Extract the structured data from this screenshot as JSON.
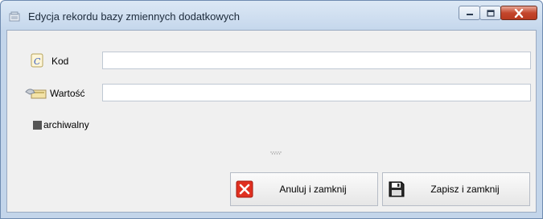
{
  "window": {
    "title": "Edycja rekordu bazy zmiennych dodatkowych",
    "controls": {
      "minimize": "minimize",
      "maximize": "maximize",
      "close": "close"
    }
  },
  "form": {
    "kod": {
      "label": "Kod",
      "value": "",
      "icon": "document-c-icon"
    },
    "wartosc": {
      "label": "Wartość",
      "value": "",
      "icon": "value-hand-icon"
    },
    "archiwalny": {
      "label": "archiwalny",
      "checked": true
    }
  },
  "buttons": {
    "cancel": {
      "label": "Anuluj i zamknij",
      "icon": "red-x-icon"
    },
    "save": {
      "label": "Zapisz i zamknij",
      "icon": "floppy-disk-icon"
    }
  },
  "colors": {
    "title_bar": "#c5d7ec",
    "close_button": "#c4472d",
    "client_bg": "#f0f0f0"
  }
}
